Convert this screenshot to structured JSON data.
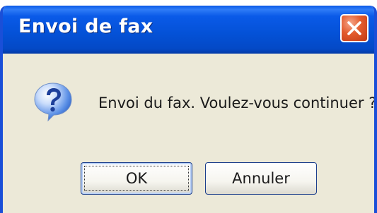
{
  "window": {
    "title": "Envoi de fax"
  },
  "dialog": {
    "icon": "question-icon",
    "message": "Envoi du fax. Voulez-vous continuer ?",
    "ok_label": "OK",
    "cancel_label": "Annuler"
  },
  "colors": {
    "titlebar": "#0451d6",
    "close_button": "#e35a2c",
    "dialog_background": "#ece9d8",
    "icon_blue": "#2d6fd6"
  }
}
